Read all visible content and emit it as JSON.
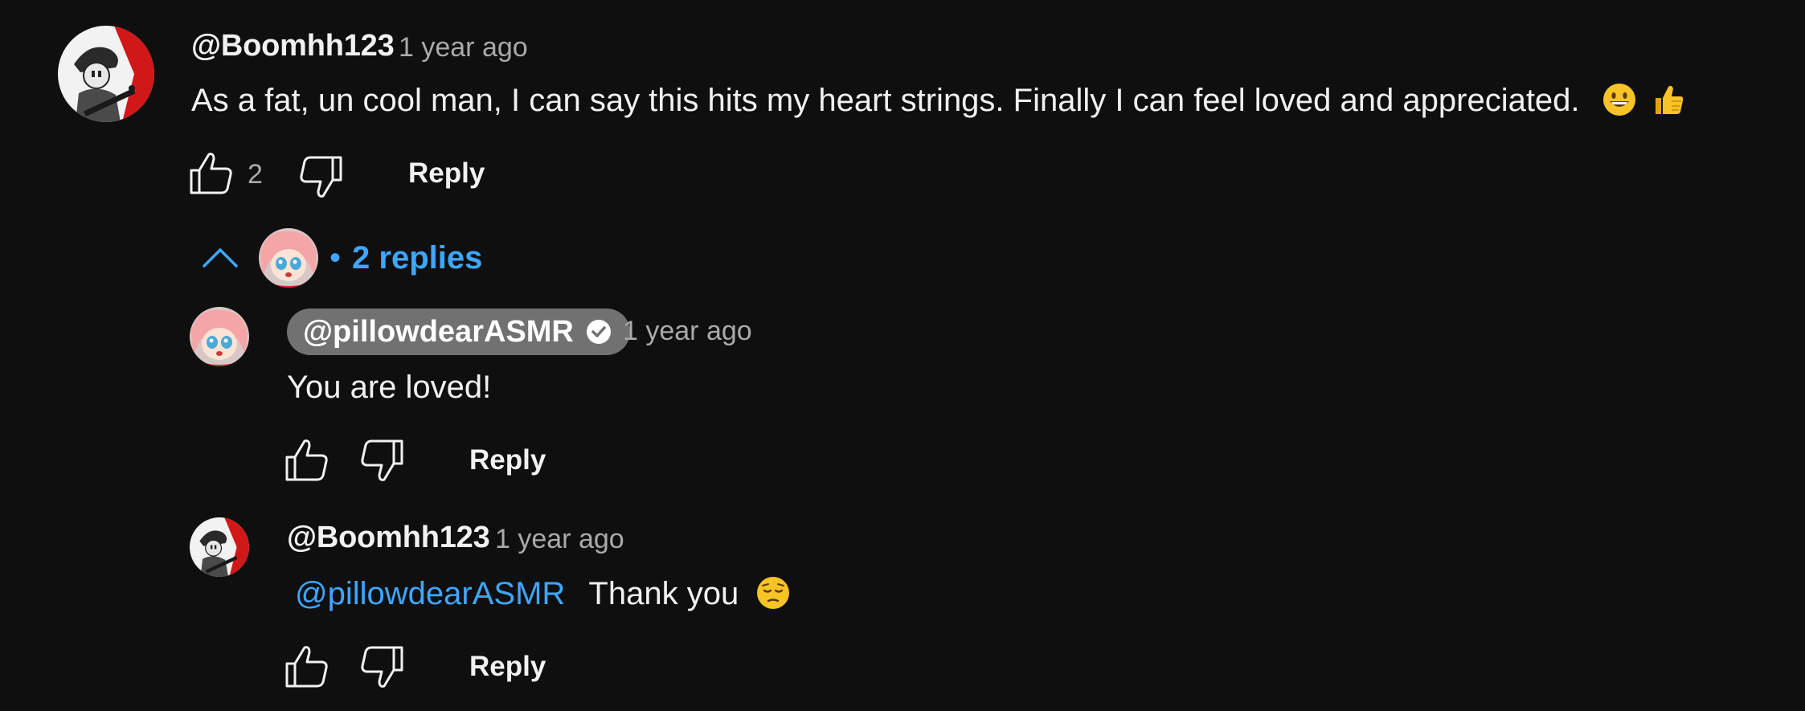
{
  "comment": {
    "author": "@Boomhh123",
    "time": "1 year ago",
    "text": "As a fat, un cool man, I can say this hits my heart strings. Finally I can feel loved and appreciated.",
    "emojis": [
      "grinning-face",
      "thumbs-up"
    ],
    "likes": "2",
    "reply_label": "Reply"
  },
  "replies_toggle": {
    "dot": "•",
    "label": "2 replies"
  },
  "replies": [
    {
      "author": "@pillowdearASMR",
      "verified": true,
      "time": "1 year ago",
      "text": "You are loved!",
      "reply_label": "Reply"
    },
    {
      "author": "@Boomhh123",
      "time": "1 year ago",
      "mention": "@pillowdearASMR",
      "text": "Thank you",
      "emoji": "pensive-face",
      "reply_label": "Reply"
    }
  ],
  "colors": {
    "background": "#0f0f0f",
    "link": "#3ea6ff",
    "creator_pill": "#717171",
    "muted": "#aaaaaa"
  }
}
